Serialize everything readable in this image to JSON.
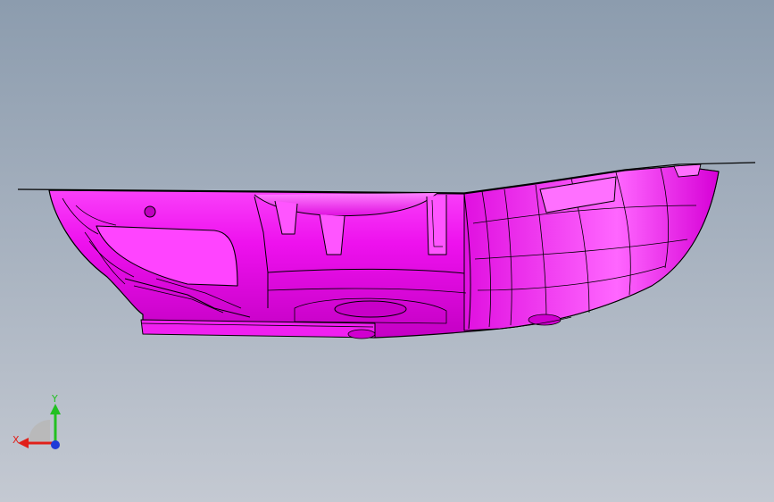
{
  "viewport": {
    "background_top": "#8c9cae",
    "background_bottom": "#c4c9d2",
    "part_color": "#ee11ee",
    "part_highlight": "#ff66ff",
    "part_shadow": "#b000b0",
    "edge_color": "#000000"
  },
  "triad": {
    "x_label": "X",
    "y_label": "Y",
    "x_color": "#e0201a",
    "y_color": "#22c022",
    "z_color": "#1f3ad8"
  }
}
